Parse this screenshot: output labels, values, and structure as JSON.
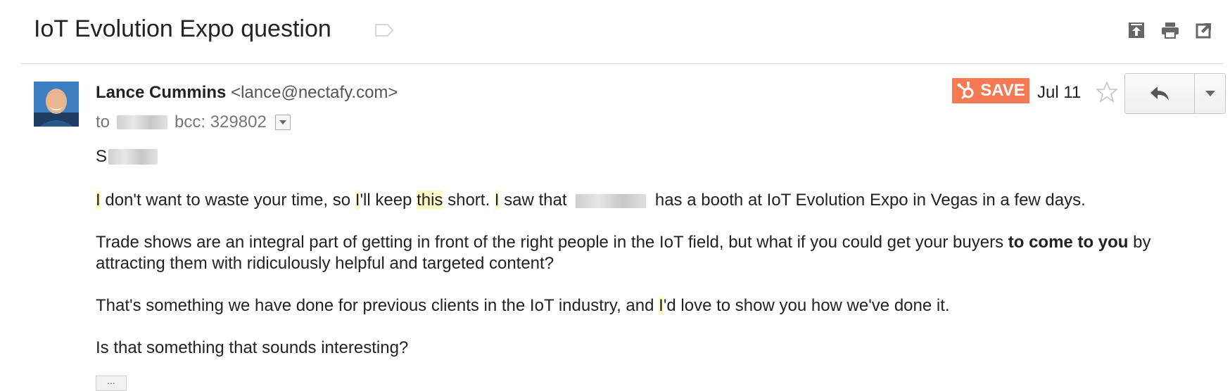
{
  "thread": {
    "subject": "IoT Evolution Expo question"
  },
  "icons": {
    "label": "label-tag-icon",
    "archive": "move-to-inbox-icon",
    "print": "print-icon",
    "new_window": "open-in-new-window-icon",
    "save": "hubspot-sprocket-icon",
    "star": "star-icon",
    "reply": "reply-arrow-icon",
    "more": "chevron-down-icon"
  },
  "message": {
    "sender_name": "Lance Cummins",
    "sender_email": "<lance@nectafy.com>",
    "to_label": "to",
    "bcc_text": "bcc: 329802",
    "date": "Jul 11",
    "save_label": "SAVE",
    "greeting_initial": "S",
    "p1_a": "I",
    "p1_b": " don't want to waste your time, so ",
    "p1_c": "I",
    "p1_d": "'ll keep ",
    "p1_e": "this",
    "p1_f": " short. ",
    "p1_g": "I",
    "p1_h": " saw that ",
    "p1_i": " has a booth at IoT Evolution Expo in Vegas in a few days.",
    "p2_a": "Trade shows are an integral part of getting in front of the right people in the IoT field, but what if you could get your buyers ",
    "p2_bold": "to come to you",
    "p2_c": " by attracting them with ridiculously helpful and targeted content?",
    "p3_a": "That's something we have done for previous clients in the IoT industry, and ",
    "p3_b": "I",
    "p3_c": "'d love to show you how we've done it.",
    "p4": "Is that something that sounds interesting?",
    "ellipsis": "..."
  },
  "colors": {
    "save_accent": "#f57a54",
    "highlight": "#fdfbc8"
  }
}
